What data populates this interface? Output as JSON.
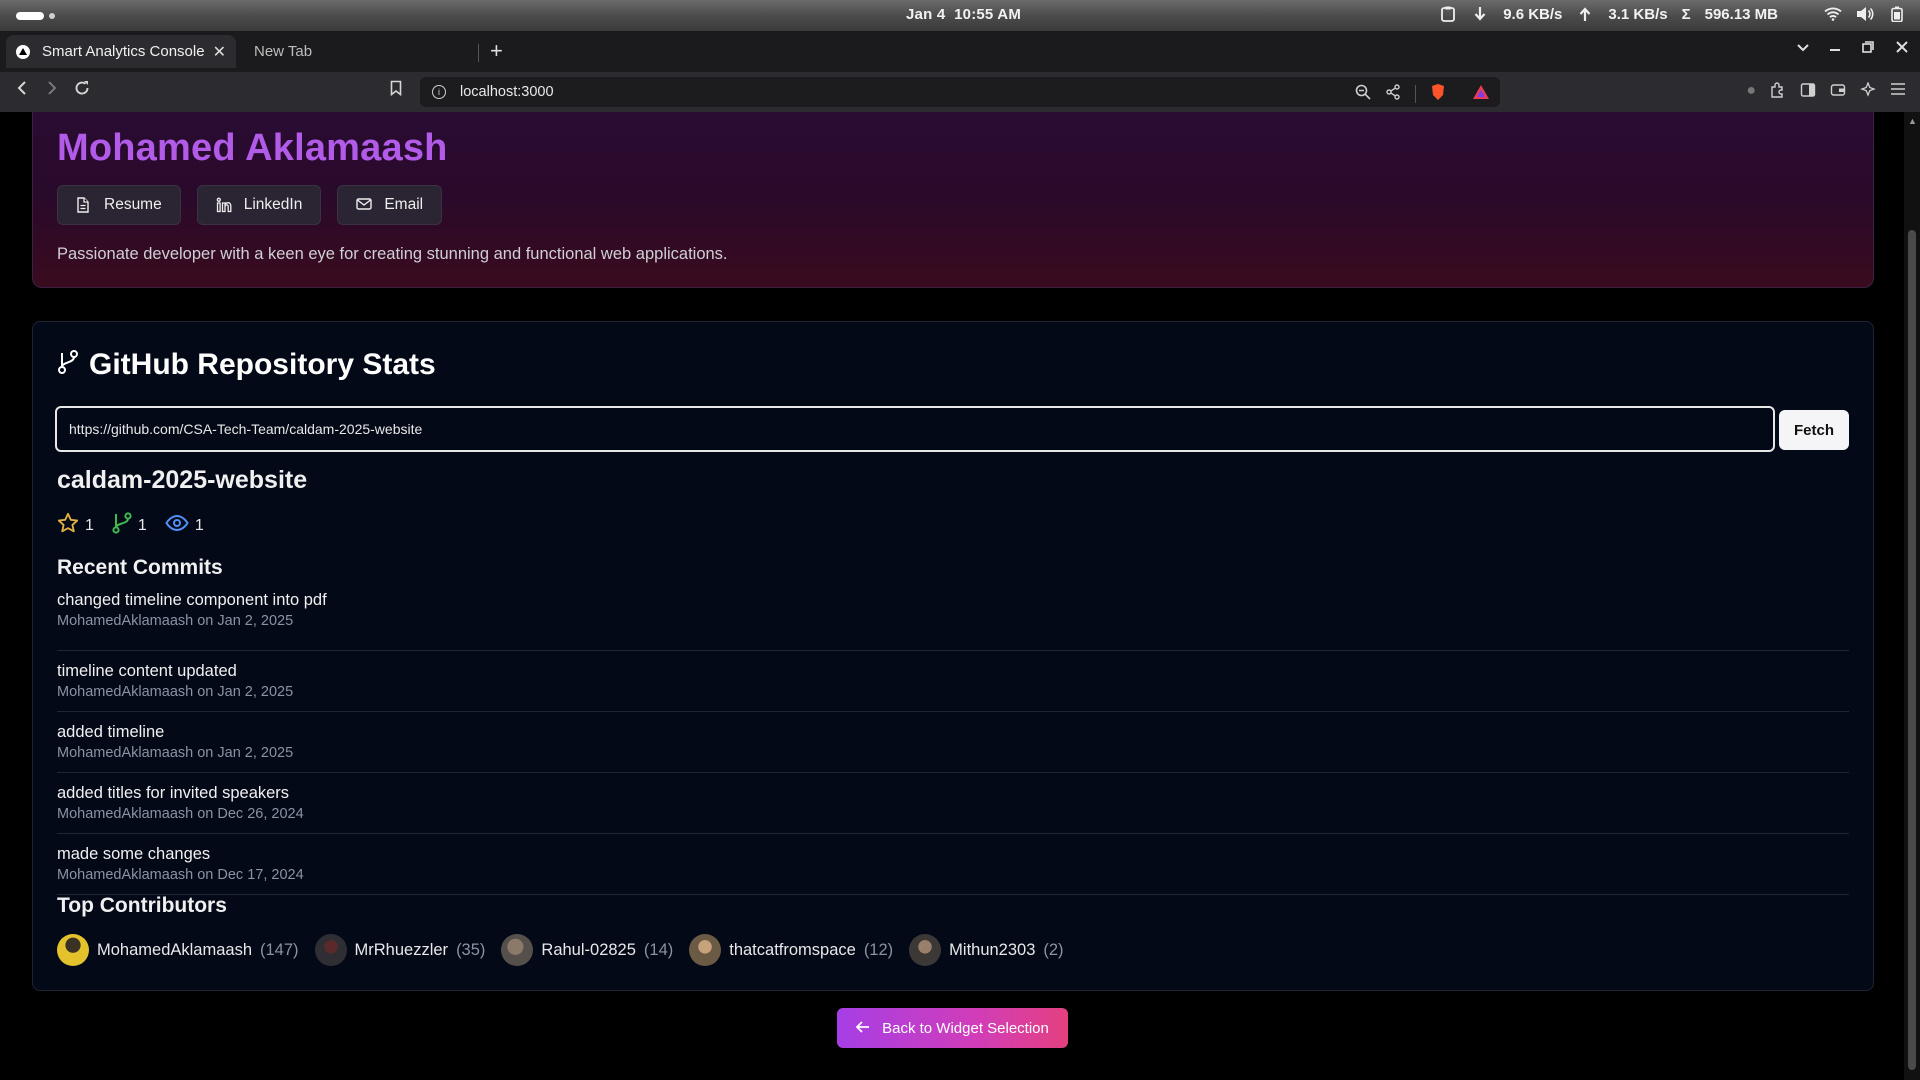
{
  "os": {
    "date": "Jan 4",
    "time": "10:55 AM",
    "download": "9.6 KB/s",
    "upload": "3.1 KB/s",
    "total": "596.13 MB"
  },
  "browser": {
    "tabs": [
      {
        "label": "Smart Analytics Console",
        "active": true
      },
      {
        "label": "New Tab",
        "active": false
      }
    ],
    "url": "localhost:3000"
  },
  "profile": {
    "name": "Mohamed Aklamaash",
    "links": [
      "Resume",
      "LinkedIn",
      "Email"
    ],
    "bio": "Passionate developer with a keen eye for creating stunning and functional web applications."
  },
  "stats": {
    "title": "GitHub Repository Stats",
    "input_value": "https://github.com/CSA-Tech-Team/caldam-2025-website",
    "fetch_label": "Fetch",
    "repo_name": "caldam-2025-website",
    "stars": "1",
    "forks": "1",
    "watchers": "1",
    "recent_commits_title": "Recent Commits",
    "commits": [
      {
        "message": "changed timeline component into pdf",
        "meta": "MohamedAklamaash on Jan 2, 2025"
      },
      {
        "message": "timeline content updated",
        "meta": "MohamedAklamaash on Jan 2, 2025"
      },
      {
        "message": "added timeline",
        "meta": "MohamedAklamaash on Jan 2, 2025"
      },
      {
        "message": "added titles for invited speakers",
        "meta": "MohamedAklamaash on Dec 26, 2024"
      },
      {
        "message": "made some changes",
        "meta": "MohamedAklamaash on Dec 17, 2024"
      }
    ],
    "top_contributors_title": "Top Contributors",
    "contributors": [
      {
        "name": "MohamedAklamaash",
        "count": "(147)"
      },
      {
        "name": "MrRhuezzler",
        "count": "(35)"
      },
      {
        "name": "Rahul-02825",
        "count": "(14)"
      },
      {
        "name": "thatcatfromspace",
        "count": "(12)"
      },
      {
        "name": "Mithun2303",
        "count": "(2)"
      }
    ]
  },
  "back_button": "Back to Widget Selection",
  "colors": {
    "accent_purple": "#b15be8",
    "star": "#e3b341",
    "fork": "#3fb950",
    "watch": "#4f8ff7"
  }
}
